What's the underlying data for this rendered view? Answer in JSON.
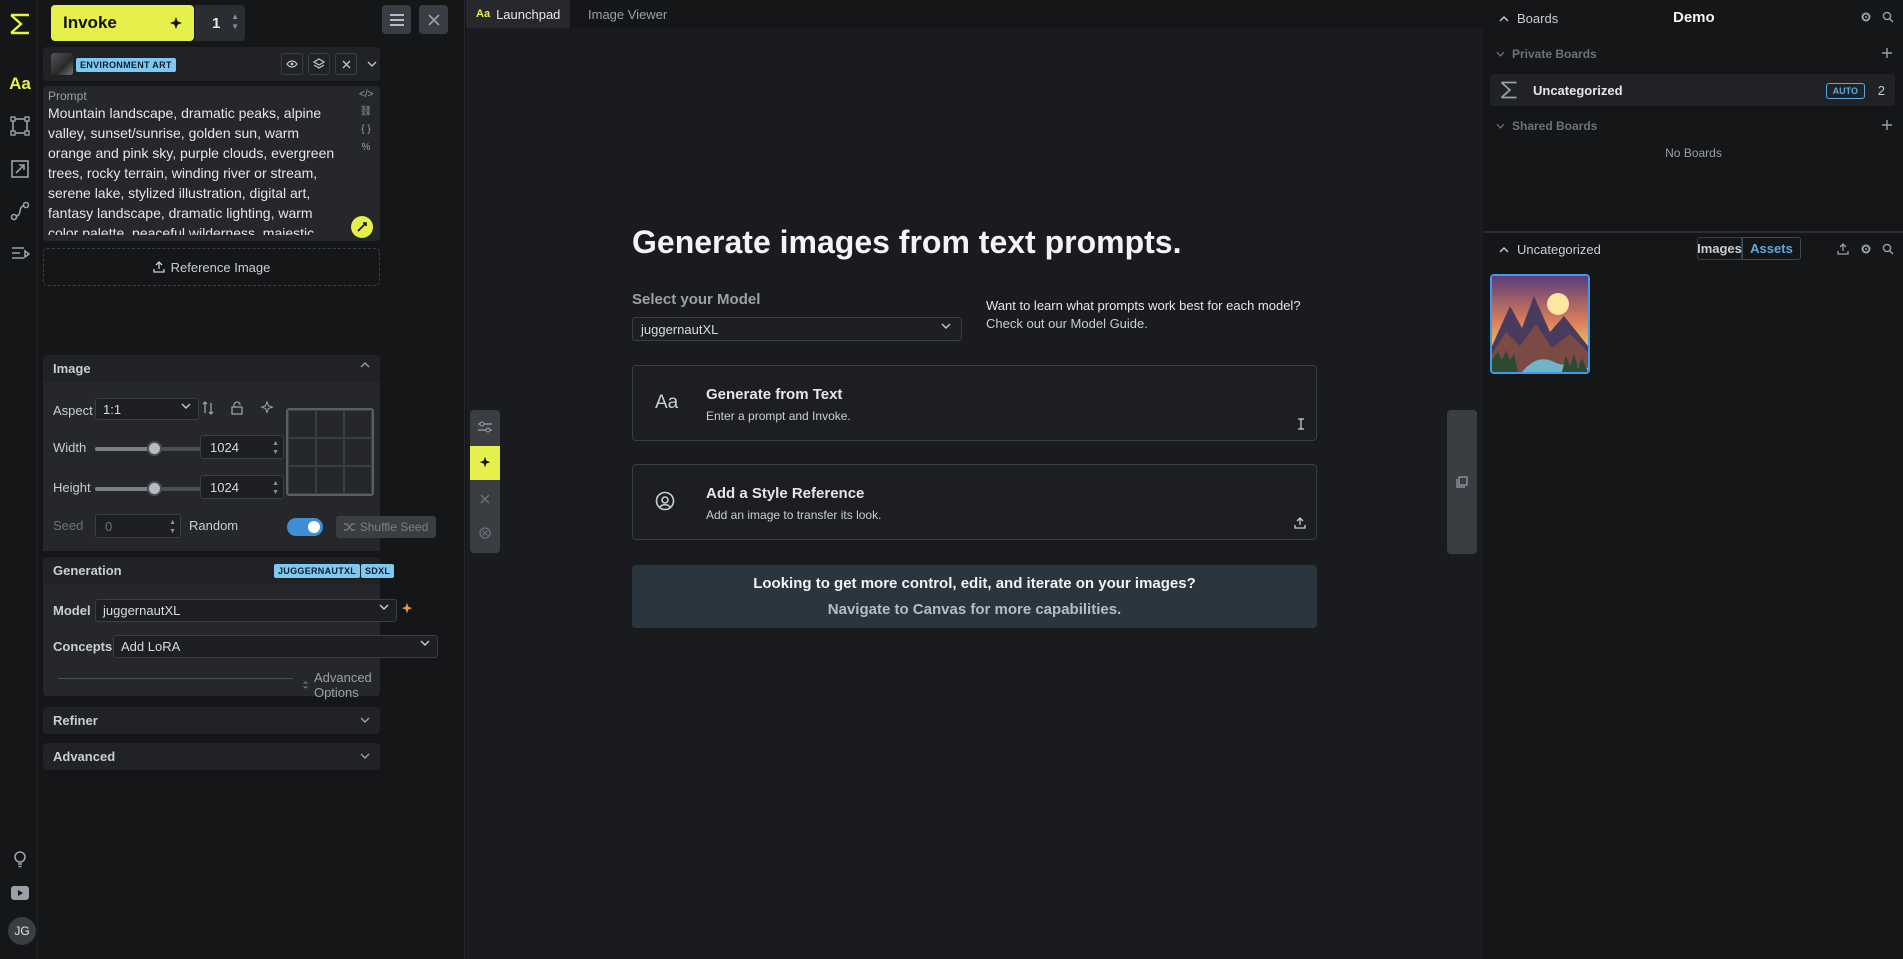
{
  "header": {
    "invoke_label": "Invoke",
    "iterations": "1"
  },
  "style_preset": {
    "tag": "ENVIRONMENT ART"
  },
  "prompt": {
    "label": "Prompt",
    "value": "Mountain landscape, dramatic peaks, alpine valley, sunset/sunrise, golden sun, warm orange and pink sky, purple clouds, evergreen trees, rocky terrain, winding river or stream, serene lake, stylized illustration, digital art, fantasy landscape, dramatic lighting, warm color palette, peaceful wilderness, majestic scenery, layered mountains, atmospheric perspective"
  },
  "reference_image_label": "Reference Image",
  "image_section": {
    "title": "Image",
    "aspect_label": "Aspect",
    "aspect_value": "1:1",
    "width_label": "Width",
    "width_value": "1024",
    "width_fraction": 0.5,
    "height_label": "Height",
    "height_value": "1024",
    "height_fraction": 0.5,
    "seed_label": "Seed",
    "seed_value": "0",
    "random_label": "Random",
    "random_on": true,
    "shuffle_label": "Shuffle Seed"
  },
  "generation": {
    "title": "Generation",
    "tags": [
      "JUGGERNAUTXL",
      "SDXL"
    ],
    "model_label": "Model",
    "model_value": "juggernautXL",
    "concepts_label": "Concepts",
    "concepts_value": "Add LoRA",
    "advanced_options": "Advanced Options"
  },
  "refiner_title": "Refiner",
  "advanced_title": "Advanced",
  "user_initials": "JG",
  "tabs": [
    "Launchpad",
    "Image Viewer"
  ],
  "tab_icon_text": "Aa",
  "launchpad": {
    "headline": "Generate images from text prompts.",
    "select_model_label": "Select your Model",
    "model_value": "juggernautXL",
    "hint_line1": "Want to learn what prompts work best for each model?",
    "hint_link": "Check out our Model Guide.",
    "cards": [
      {
        "title": "Generate from Text",
        "subtitle": "Enter a prompt and Invoke.",
        "icon": "Aa"
      },
      {
        "title": "Add a Style Reference",
        "subtitle": "Add an image to transfer its look."
      }
    ],
    "cta_line1": "Looking to get more control, edit, and iterate on your images?",
    "cta_line2": "Navigate to Canvas for more capabilities."
  },
  "boards": {
    "title": "Boards",
    "board_name": "Demo",
    "private_label": "Private Boards",
    "uncategorized": "Uncategorized",
    "auto_badge": "AUTO",
    "count": "2",
    "shared_label": "Shared Boards",
    "no_boards": "No Boards"
  },
  "gallery": {
    "title": "Uncategorized",
    "images_tab": "Images",
    "assets_tab": "Assets"
  },
  "colors": {
    "accent": "#e6f04a",
    "link_blue": "#5aa9e6",
    "background": "#1a1b1e"
  }
}
